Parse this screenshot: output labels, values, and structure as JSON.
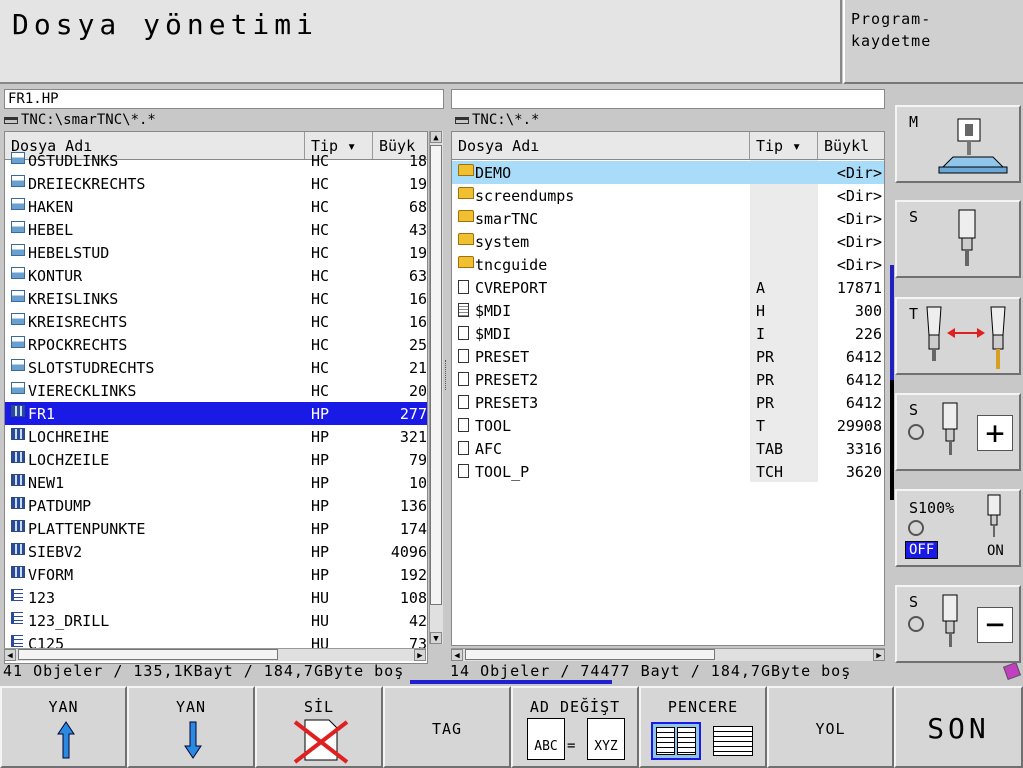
{
  "window": {
    "title": "Dosya yönetimi",
    "mode_line1": "Program-",
    "mode_line2": "kaydetme"
  },
  "left": {
    "path_input": "FR1.HP",
    "dir": "TNC:\\smarTNC\\*.*",
    "columns": [
      "Dosya Adı",
      "Tip",
      "Büyk"
    ],
    "rows": [
      {
        "name": "OSTUDLINKS",
        "type": "HC",
        "size": "18",
        "icon": "hc"
      },
      {
        "name": "DREIECKRECHTS",
        "type": "HC",
        "size": "19",
        "icon": "hc"
      },
      {
        "name": "HAKEN",
        "type": "HC",
        "size": "68",
        "icon": "hc"
      },
      {
        "name": "HEBEL",
        "type": "HC",
        "size": "43",
        "icon": "hc"
      },
      {
        "name": "HEBELSTUD",
        "type": "HC",
        "size": "19",
        "icon": "hc"
      },
      {
        "name": "KONTUR",
        "type": "HC",
        "size": "63",
        "icon": "hc"
      },
      {
        "name": "KREISLINKS",
        "type": "HC",
        "size": "16",
        "icon": "hc"
      },
      {
        "name": "KREISRECHTS",
        "type": "HC",
        "size": "16",
        "icon": "hc"
      },
      {
        "name": "RPOCKRECHTS",
        "type": "HC",
        "size": "25",
        "icon": "hc"
      },
      {
        "name": "SLOTSTUDRECHTS",
        "type": "HC",
        "size": "21",
        "icon": "hc"
      },
      {
        "name": "VIERECKLINKS",
        "type": "HC",
        "size": "20",
        "icon": "hc"
      },
      {
        "name": "FR1",
        "type": "HP",
        "size": "277",
        "icon": "hp",
        "selected": true
      },
      {
        "name": "LOCHREIHE",
        "type": "HP",
        "size": "321",
        "icon": "hp"
      },
      {
        "name": "LOCHZEILE",
        "type": "HP",
        "size": "79",
        "icon": "hp"
      },
      {
        "name": "NEW1",
        "type": "HP",
        "size": "10",
        "icon": "hp"
      },
      {
        "name": "PATDUMP",
        "type": "HP",
        "size": "136",
        "icon": "hp"
      },
      {
        "name": "PLATTENPUNKTE",
        "type": "HP",
        "size": "174",
        "icon": "hp"
      },
      {
        "name": "SIEBV2",
        "type": "HP",
        "size": "4096",
        "icon": "hp"
      },
      {
        "name": "VFORM",
        "type": "HP",
        "size": "192",
        "icon": "hp"
      },
      {
        "name": "123",
        "type": "HU",
        "size": "108",
        "icon": "hu"
      },
      {
        "name": "123_DRILL",
        "type": "HU",
        "size": "42",
        "icon": "hu"
      },
      {
        "name": "C125",
        "type": "HU",
        "size": "73",
        "icon": "hu"
      }
    ],
    "status": "41 Objeler / 135,1KBayt / 184,7GByte boş"
  },
  "right": {
    "path_input": "",
    "dir": "TNC:\\*.*",
    "columns": [
      "Dosya Adı",
      "Tip",
      "Büykl"
    ],
    "rows": [
      {
        "name": "DEMO",
        "type": "",
        "size": "<Dir>",
        "icon": "fold",
        "selected": true
      },
      {
        "name": "screendumps",
        "type": "",
        "size": "<Dir>",
        "icon": "fold"
      },
      {
        "name": "smarTNC",
        "type": "",
        "size": "<Dir>",
        "icon": "fold"
      },
      {
        "name": "system",
        "type": "",
        "size": "<Dir>",
        "icon": "fold"
      },
      {
        "name": "tncguide",
        "type": "",
        "size": "<Dir>",
        "icon": "fold"
      },
      {
        "name": "CVREPORT",
        "type": "A",
        "size": "17871",
        "icon": "file"
      },
      {
        "name": "$MDI",
        "type": "H",
        "size": "300",
        "icon": "doc"
      },
      {
        "name": "$MDI",
        "type": "I",
        "size": "226",
        "icon": "file"
      },
      {
        "name": "PRESET",
        "type": "PR",
        "size": "6412",
        "icon": "file"
      },
      {
        "name": "PRESET2",
        "type": "PR",
        "size": "6412",
        "icon": "file"
      },
      {
        "name": "PRESET3",
        "type": "PR",
        "size": "6412",
        "icon": "file"
      },
      {
        "name": "TOOL",
        "type": "T",
        "size": "29908",
        "icon": "file"
      },
      {
        "name": "AFC",
        "type": "TAB",
        "size": "3316",
        "icon": "file"
      },
      {
        "name": "TOOL_P",
        "type": "TCH",
        "size": "3620",
        "icon": "file"
      }
    ],
    "status": "14 Objeler / 74477 Bayt / 184,7GByte boş"
  },
  "side": {
    "m": "M",
    "s1": "S",
    "t": "T",
    "s2": "S",
    "s100": "S100%",
    "off": "OFF",
    "on": "ON",
    "s3": "S"
  },
  "softkeys": {
    "yan1": "YAN",
    "yan2": "YAN",
    "sil": "SİL",
    "tag": "TAG",
    "ad_degist": "AD DEĞİŞT",
    "abc": "ABC",
    "eq": "=",
    "xyz": "XYZ",
    "pencere": "PENCERE",
    "yol": "YOL",
    "son": "SON"
  },
  "colors": {
    "selection": "#1a1ae6",
    "highlight": "#a8dcf8",
    "arrow": "#2a8ae0",
    "delete": "#e02020"
  }
}
